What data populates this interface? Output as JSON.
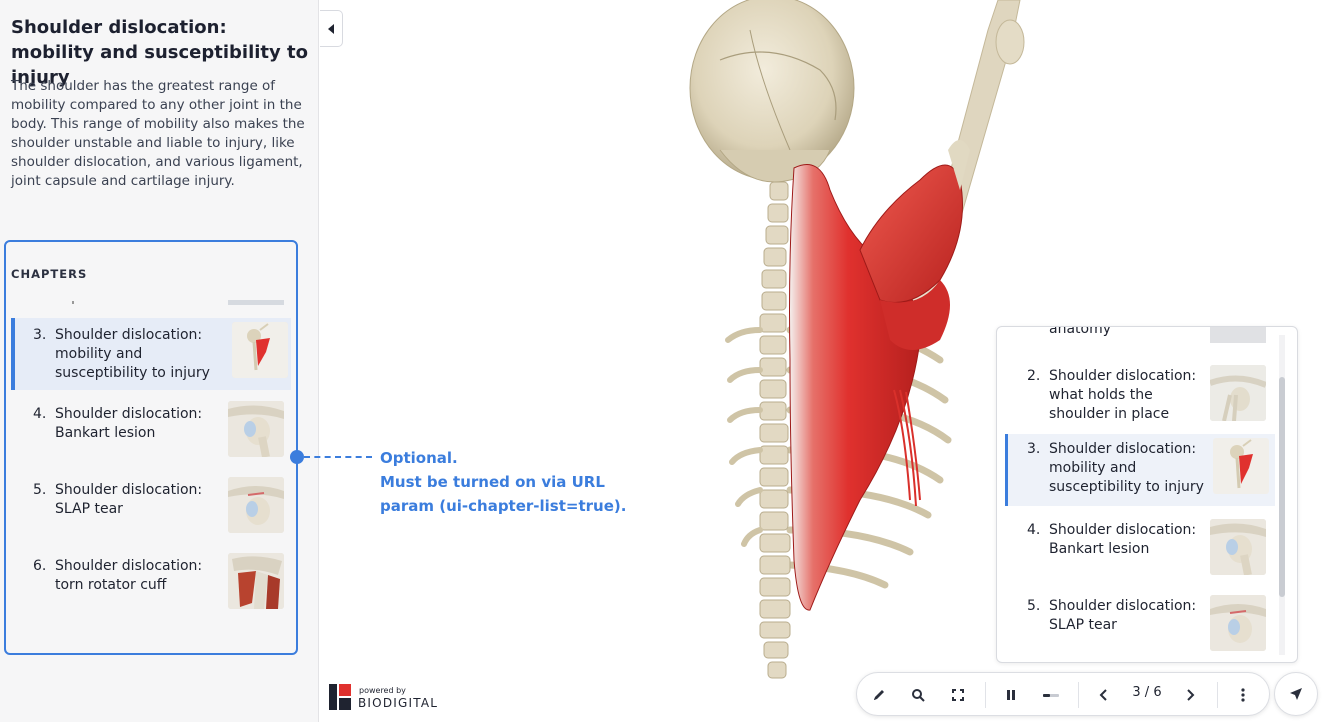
{
  "sidebar": {
    "title": "Shoulder dislocation: mobility and susceptibility to injury",
    "description": "The shoulder has the greatest range of mobility compared to any other joint in the body. This range of mobility also makes the shoulder unstable and liable to injury, like shoulder dislocation, and various ligament, joint capsule and cartilage injury.",
    "chapters_heading": "CHAPTERS",
    "chapters": [
      {
        "num": "3.",
        "label": "Shoulder dislocation: mobility and susceptibility to injury",
        "active": true,
        "thumb": "skeleton-muscle-thumb"
      },
      {
        "num": "4.",
        "label": "Shoulder dislocation: Bankart lesion",
        "active": false,
        "thumb": "shoulder-joint-thumb"
      },
      {
        "num": "5.",
        "label": "Shoulder dislocation: SLAP tear",
        "active": false,
        "thumb": "shoulder-joint-thumb"
      },
      {
        "num": "6.",
        "label": "Shoulder dislocation: torn rotator cuff",
        "active": false,
        "thumb": "rotator-cuff-thumb"
      }
    ]
  },
  "annotation": {
    "line1": "Optional.",
    "line2": "Must be turned on via URL",
    "line3": "param (ui-chapter-list=true)."
  },
  "right_panel": {
    "cut_label": "anatomy",
    "chapters": [
      {
        "num": "2.",
        "label": "Shoulder dislocation: what holds the shoulder in place",
        "active": false
      },
      {
        "num": "3.",
        "label": "Shoulder dislocation: mobility and susceptibility to injury",
        "active": true
      },
      {
        "num": "4.",
        "label": "Shoulder dislocation: Bankart lesion",
        "active": false
      },
      {
        "num": "5.",
        "label": "Shoulder dislocation: SLAP tear",
        "active": false
      }
    ]
  },
  "toolbar": {
    "page_indicator": "3 / 6",
    "icons": [
      "pencil-icon",
      "search-icon",
      "fullscreen-icon",
      "pause-icon",
      "slider-icon",
      "chevron-left-icon",
      "chevron-right-icon",
      "more-vertical-icon"
    ]
  },
  "logo": {
    "small": "powered by",
    "big": "BIODIGITAL"
  },
  "colors": {
    "accent": "#3b7ddd",
    "muscle": "#e0312e",
    "bone": "#e8e1cf"
  }
}
